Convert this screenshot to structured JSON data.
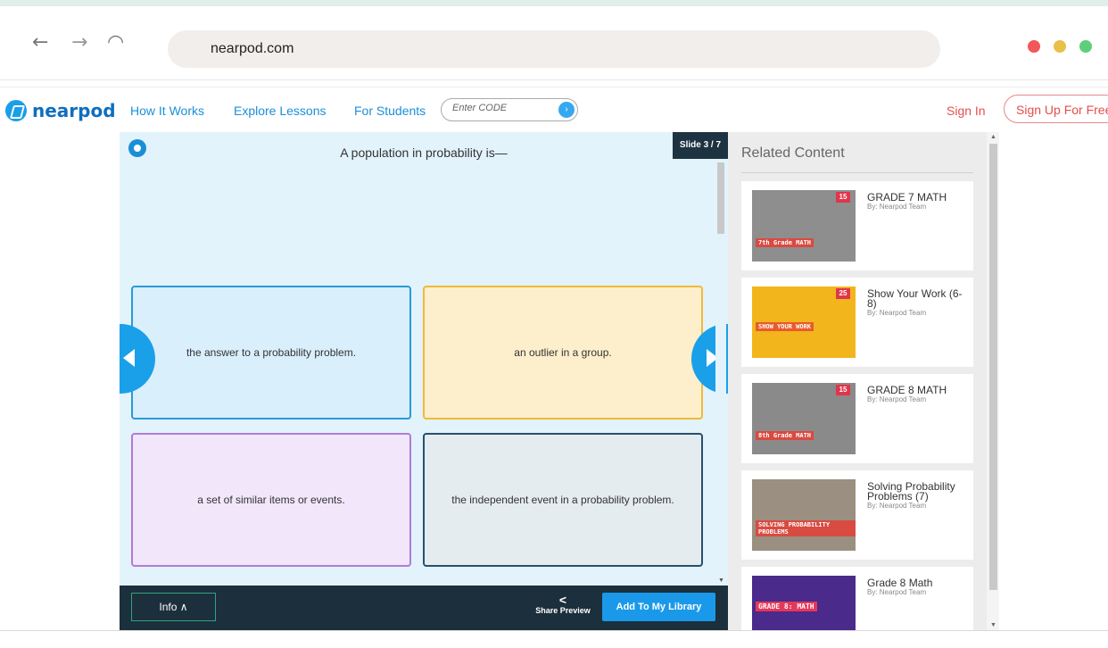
{
  "browser": {
    "url": "nearpod.com",
    "back_glyph": "←",
    "forward_glyph": "→",
    "reload_glyph": "◠",
    "window_dot_colors": [
      "#f2575a",
      "#e8c04a",
      "#5fce7a"
    ]
  },
  "header": {
    "logo_text": "nearpod",
    "nav": [
      "How It Works",
      "Explore Lessons",
      "For Students"
    ],
    "code_placeholder": "Enter CODE",
    "code_go_glyph": "›",
    "sign_in": "Sign In",
    "sign_up": "Sign Up For Free"
  },
  "slide": {
    "question": "A population in probability is—",
    "slide_counter": "Slide 3 / 7",
    "answers": [
      {
        "text": "the answer to a probability problem.",
        "bg": "#d9effc",
        "border": "#2a9ad6"
      },
      {
        "text": "an outlier in a group.",
        "bg": "#fdefcb",
        "border": "#f0b93a"
      },
      {
        "text": "a set of similar items or events.",
        "bg": "#f1e6fa",
        "border": "#b27ad8"
      },
      {
        "text": "the independent event in a probability problem.",
        "bg": "#e5ecf0",
        "border": "#28506a"
      }
    ]
  },
  "footer": {
    "info_label": "Info ∧",
    "share_icon": "<",
    "share_label": "Share Preview",
    "add_label": "Add To My Library"
  },
  "related": {
    "title": "Related Content",
    "items": [
      {
        "title": "GRADE 7 MATH",
        "author": "By: Nearpod Team",
        "thumb_label": "7th Grade MATH",
        "badge": "15",
        "thumb_bg": "#8e8e8e",
        "label_bg": "#d94a41"
      },
      {
        "title": "Show Your Work (6-8)",
        "author": "By: Nearpod Team",
        "thumb_label": "SHOW YOUR WORK",
        "badge": "25",
        "thumb_bg": "#f2b51c",
        "label_bg": "#e85a2c"
      },
      {
        "title": "GRADE 8 MATH",
        "author": "By: Nearpod Team",
        "thumb_label": "8th Grade MATH",
        "badge": "15",
        "thumb_bg": "#8a8a8a",
        "label_bg": "#d94a41"
      },
      {
        "title": "Solving Probability Problems (7)",
        "author": "By: Nearpod Team",
        "thumb_label": "SOLVING PROBABILITY PROBLEMS",
        "badge": "",
        "thumb_bg": "#9a8f80",
        "label_bg": "#d94a41"
      },
      {
        "title": "Grade 8 Math",
        "author": "By: Nearpod Team",
        "thumb_label": "GRADE 8: MATH",
        "badge": "",
        "thumb_bg": "#4a2a8a",
        "label_bg": "#e5375a"
      }
    ]
  }
}
